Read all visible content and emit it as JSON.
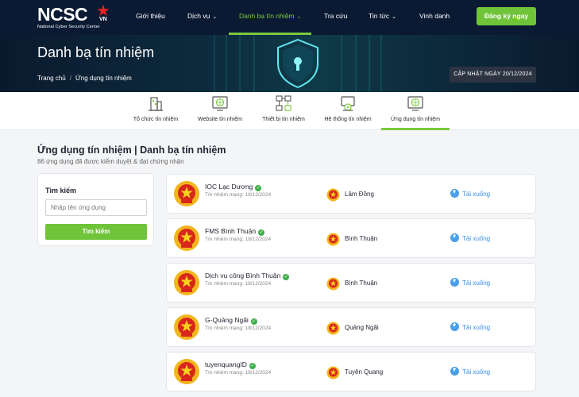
{
  "header": {
    "logo_text": "NCSC",
    "logo_vn": "VN",
    "logo_sub": "National Cyber Security Center",
    "nav": [
      {
        "label": "Giới thiệu",
        "has_dropdown": false
      },
      {
        "label": "Dịch vụ",
        "has_dropdown": true
      },
      {
        "label": "Danh bạ tín nhiệm",
        "has_dropdown": true,
        "active": true
      },
      {
        "label": "Tra cứu",
        "has_dropdown": false
      },
      {
        "label": "Tin tức",
        "has_dropdown": true
      },
      {
        "label": "Vinh danh",
        "has_dropdown": false
      }
    ],
    "register_label": "Đăng ký ngay"
  },
  "banner": {
    "title": "Danh bạ tín nhiệm",
    "breadcrumb": [
      "Trang chủ",
      "Ứng dụng tín nhiệm"
    ],
    "update_label": "CẬP NHẬT NGÀY 20/12/2024"
  },
  "tabs": [
    {
      "label": "Tổ chức tín nhiệm",
      "icon": "building-icon"
    },
    {
      "label": "Website tín nhiệm",
      "icon": "website-icon"
    },
    {
      "label": "Thiết bị tín nhiệm",
      "icon": "device-icon"
    },
    {
      "label": "Hệ thống tín nhiệm",
      "icon": "system-icon"
    },
    {
      "label": "Ứng dụng tín nhiệm",
      "icon": "app-icon",
      "active": true
    }
  ],
  "section": {
    "title": "Ứng dụng tín nhiệm | Danh bạ tín nhiệm",
    "subtitle": "86 ứng dụng đã được kiểm duyệt & đạt chứng nhận"
  },
  "search": {
    "label": "Tìm kiếm",
    "placeholder": "Nhập tên ứng dụng",
    "button": "Tìm kiếm"
  },
  "items": [
    {
      "name": "IOC Lạc Dương",
      "date": "Tín nhiệm mạng: 18/12/2024",
      "province": "Lâm Đồng",
      "download": "Tải xuống"
    },
    {
      "name": "FMS Bình Thuận",
      "date": "Tín nhiệm mạng: 18/12/2024",
      "province": "Bình Thuận",
      "download": "Tải xuống"
    },
    {
      "name": "Dịch vụ công Bình Thuận",
      "date": "Tín nhiệm mạng: 18/12/2024",
      "province": "Bình Thuận",
      "download": "Tải xuống"
    },
    {
      "name": "G-Quảng Ngãi",
      "date": "Tín nhiệm mạng: 18/12/2024",
      "province": "Quảng Ngãi",
      "download": "Tải xuống"
    },
    {
      "name": "tuyenquangID",
      "date": "Tín nhiệm mạng: 18/12/2024",
      "province": "Tuyên Quang",
      "download": "Tải xuống"
    }
  ],
  "colors": {
    "brand_green": "#6fc43a",
    "nav_bg": "#0b1a33",
    "link_blue": "#3a8ee6"
  }
}
